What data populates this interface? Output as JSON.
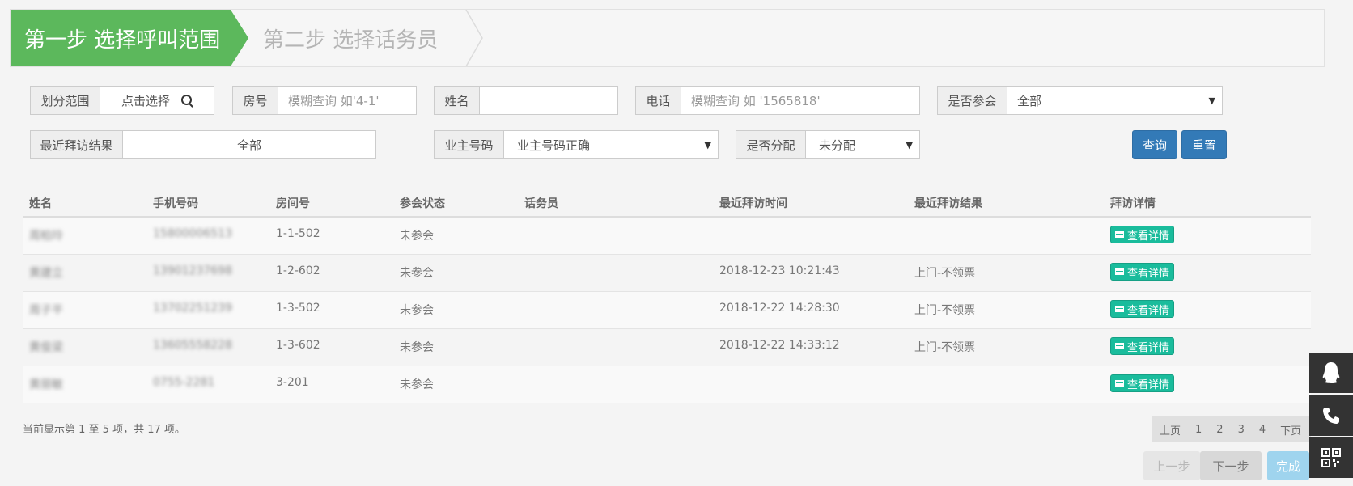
{
  "wizard": {
    "step1": "第一步 选择呼叫范围",
    "step2": "第二步 选择话务员"
  },
  "filters": {
    "scope": {
      "label": "划分范围",
      "value": "点击选择"
    },
    "room": {
      "label": "房号",
      "placeholder": "模糊查询 如'4-1'"
    },
    "name": {
      "label": "姓名",
      "value": ""
    },
    "phone": {
      "label": "电话",
      "placeholder": "模糊查询 如 '1565818'"
    },
    "attend": {
      "label": "是否参会",
      "value": "全部"
    },
    "visit_result": {
      "label": "最近拜访结果",
      "value": "全部"
    },
    "owner_number": {
      "label": "业主号码",
      "value": "业主号码正确"
    },
    "assigned": {
      "label": "是否分配",
      "value": "未分配"
    },
    "query_button": "查询",
    "reset_button": "重置"
  },
  "table": {
    "headers": [
      "姓名",
      "手机号码",
      "房间号",
      "参会状态",
      "话务员",
      "最近拜访时间",
      "最近拜访结果",
      "拜访详情"
    ],
    "rows": [
      {
        "name": "周柏玲",
        "phone": "15800006513",
        "room": "1-1-502",
        "status": "未参会",
        "operator": "",
        "time": "",
        "result": "",
        "detail": "查看详情"
      },
      {
        "name": "黄建立",
        "phone": "13901237698",
        "room": "1-2-602",
        "status": "未参会",
        "operator": "",
        "time": "2018-12-23 10:21:43",
        "result": "上门-不领票",
        "detail": "查看详情"
      },
      {
        "name": "周子平",
        "phone": "13702251239",
        "room": "1-3-502",
        "status": "未参会",
        "operator": "",
        "time": "2018-12-22 14:28:30",
        "result": "上门-不领票",
        "detail": "查看详情"
      },
      {
        "name": "黄俊梁",
        "phone": "13605558228",
        "room": "1-3-602",
        "status": "未参会",
        "operator": "",
        "time": "2018-12-22 14:33:12",
        "result": "上门-不领票",
        "detail": "查看详情"
      },
      {
        "name": "黄丽敏",
        "phone": "0755-2281",
        "room": "3-201",
        "status": "未参会",
        "operator": "",
        "time": "",
        "result": "",
        "detail": "查看详情"
      }
    ]
  },
  "footer": {
    "info": "当前显示第 1 至 5 项，共 17 项。",
    "pager": {
      "prev": "上页",
      "pages": [
        "1",
        "2",
        "3",
        "4"
      ],
      "next": "下页"
    },
    "prev_step": "上一步",
    "next_step": "下一步",
    "finish": "完成"
  },
  "colors": {
    "step_active": "#5cb85c",
    "primary": "#337ab7",
    "detail": "#1abc9c"
  },
  "side_icons": [
    "qq-icon",
    "phone-icon",
    "qrcode-icon"
  ]
}
